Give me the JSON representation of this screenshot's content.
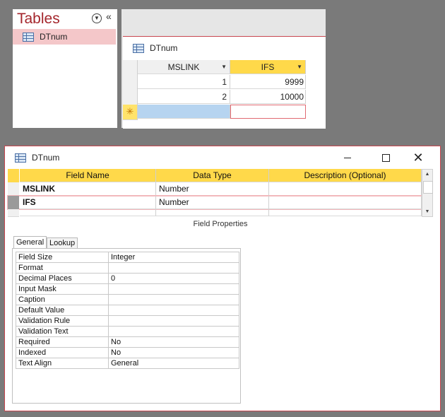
{
  "nav": {
    "title": "Tables",
    "items": [
      {
        "label": "DTnum",
        "selected": true
      }
    ]
  },
  "datasheet": {
    "tab_title": "DTnum",
    "columns": [
      "MSLINK",
      "IFS"
    ],
    "rows": [
      [
        "1",
        "9999"
      ],
      [
        "2",
        "10000"
      ]
    ],
    "new_row_marker": "✳"
  },
  "design": {
    "window_title": "DTnum",
    "columns": [
      "Field Name",
      "Data Type",
      "Description (Optional)"
    ],
    "fields": [
      {
        "name": "MSLINK",
        "type": "Number",
        "description": ""
      },
      {
        "name": "IFS",
        "type": "Number",
        "description": "",
        "selected": true
      }
    ],
    "field_properties_title": "Field Properties",
    "tabs": [
      "General",
      "Lookup"
    ],
    "properties": [
      {
        "k": "Field Size",
        "v": "Integer"
      },
      {
        "k": "Format",
        "v": ""
      },
      {
        "k": "Decimal Places",
        "v": "0"
      },
      {
        "k": "Input Mask",
        "v": ""
      },
      {
        "k": "Caption",
        "v": ""
      },
      {
        "k": "Default Value",
        "v": ""
      },
      {
        "k": "Validation Rule",
        "v": ""
      },
      {
        "k": "Validation Text",
        "v": ""
      },
      {
        "k": "Required",
        "v": "No"
      },
      {
        "k": "Indexed",
        "v": "No"
      },
      {
        "k": "Text Align",
        "v": "General"
      }
    ]
  },
  "colors": {
    "accent_red": "#a4262c",
    "header_yellow": "#ffd94a",
    "selected_nav": "#f4c7c9"
  }
}
